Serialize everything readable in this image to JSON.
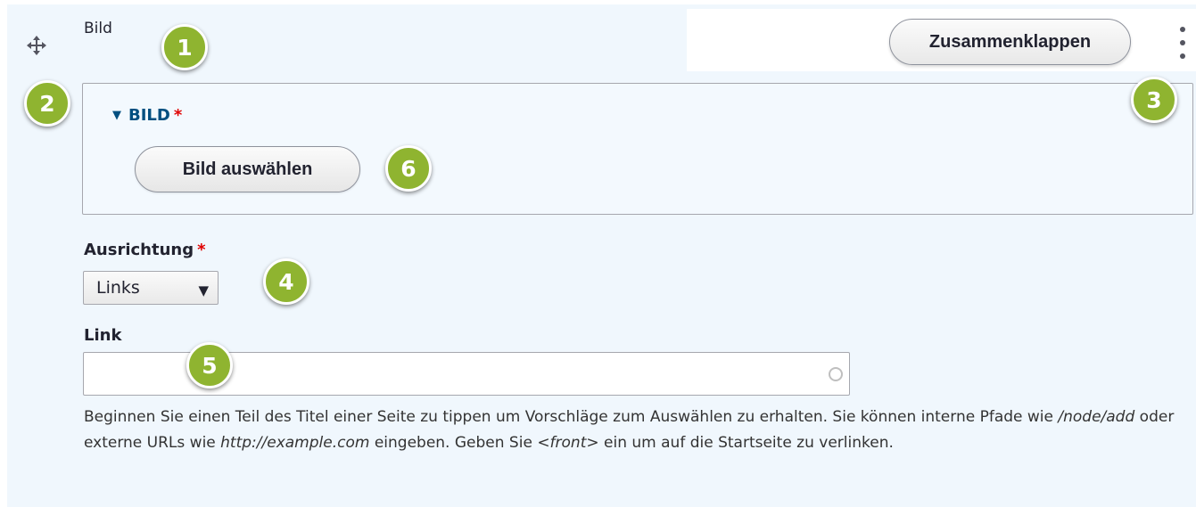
{
  "paragraph": {
    "type_label": "Bild",
    "collapse_label": "Zusammenklappen"
  },
  "image_fieldset": {
    "legend": "BILD",
    "required_mark": "*",
    "select_button": "Bild auswählen"
  },
  "alignment": {
    "label": "Ausrichtung",
    "required_mark": "*",
    "selected": "Links"
  },
  "link": {
    "label": "Link",
    "value": "",
    "help_parts": [
      "Beginnen Sie einen Teil des Titel einer Seite zu tippen um Vorschläge zum Auswählen zu erhalten. Sie können interne Pfade wie ",
      "/node/add",
      " oder externe URLs wie ",
      "http://example.com",
      " eingeben. Geben Sie ",
      "<front>",
      " ein um auf die Startseite zu verlinken."
    ]
  },
  "markers": [
    "1",
    "2",
    "3",
    "4",
    "5",
    "6"
  ],
  "colors": {
    "marker": "#8fb430",
    "legend": "#004f80",
    "required": "#e00000",
    "panel": "#f0f7fd"
  },
  "icons": {
    "drag": "drag-handle-icon",
    "menu": "kebab-menu-icon",
    "throbber": "autocomplete-throbber-icon"
  }
}
